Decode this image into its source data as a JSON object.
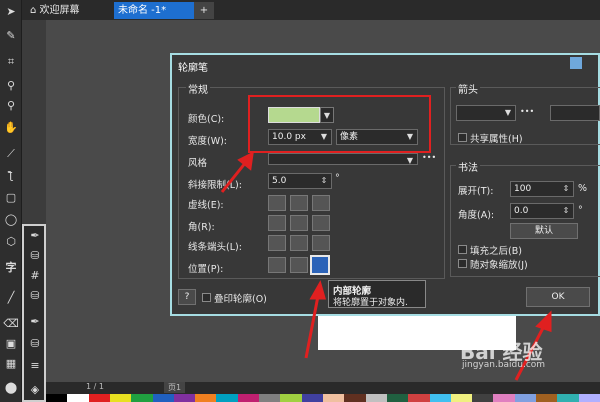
{
  "tabs": {
    "home": "欢迎屏幕",
    "doc": "未命名 -1*",
    "add": "+"
  },
  "dialog": {
    "title": "轮廓笔",
    "general": {
      "title": "常规",
      "color_label": "颜色(C):",
      "color_value": "#b5d98f",
      "width_label": "宽度(W):",
      "width_value": "10.0 px",
      "unit_value": "像素",
      "style_label": "风格",
      "miter_label": "斜接限制(L):",
      "miter_value": "5.0",
      "miter_unit": "°",
      "dash_label": "虚线(E):",
      "corner_label": "角(R):",
      "cap_label": "线条端头(L):",
      "position_label": "位置(P):",
      "more_dots": "•••"
    },
    "arrows": {
      "title": "箭头",
      "share_label": "共享属性(H)"
    },
    "calligraphy": {
      "title": "书法",
      "stretch_label": "展开(T):",
      "stretch_value": "100",
      "stretch_unit": "%",
      "angle_label": "角度(A):",
      "angle_value": "0.0",
      "angle_unit": "°",
      "default_button": "默认",
      "fill_behind_label": "填充之后(B)",
      "scale_label": "随对象缩放(J)"
    },
    "help_button": "?",
    "overprint_label": "叠印轮廓(O)",
    "ok_button": "OK"
  },
  "tooltip": {
    "title": "内部轮廓",
    "desc": "将轮廓置于对象内."
  },
  "status": {
    "page_nav": "1 / 1",
    "page_tab": "页1"
  },
  "watermark": {
    "text": "Bai 经验",
    "url": "jingyan.baidu.com"
  },
  "colors": {
    "accent_red": "#e02020",
    "dialog_border": "#a6dde3",
    "selected_blue": "#2b63b8"
  },
  "palette": [
    "#000000",
    "#ffffff",
    "#e02020",
    "#e8e020",
    "#20a040",
    "#2060c0",
    "#8030a0",
    "#f08020",
    "#00a0c0",
    "#c02070",
    "#808080",
    "#a0d040",
    "#4040a0",
    "#f0c0a0",
    "#603020",
    "#c0c0c0",
    "#206040",
    "#d04040",
    "#40c0f0",
    "#f0f080",
    "#404040",
    "#e080c0",
    "#80a0e0",
    "#a06020",
    "#30b0b0",
    "#b0b0ff"
  ]
}
